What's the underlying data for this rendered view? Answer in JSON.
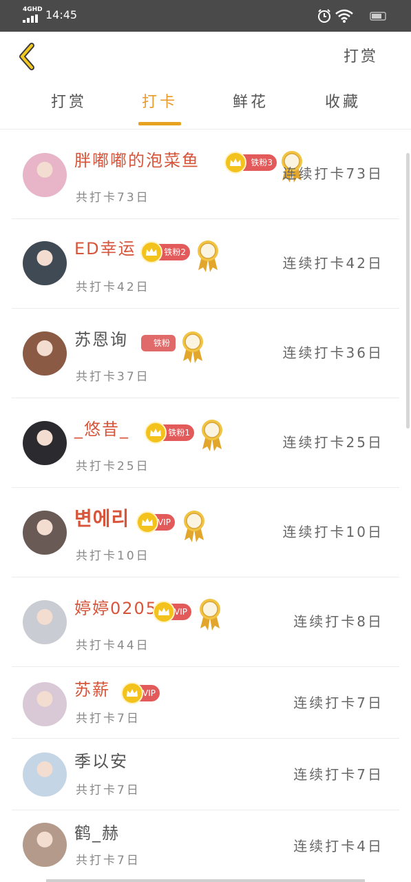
{
  "status_bar": {
    "network": "4GHD",
    "time": "14:45"
  },
  "header": {
    "right_link": "打赏"
  },
  "tabs": [
    {
      "label": "打赏",
      "active": false
    },
    {
      "label": "打卡",
      "active": true
    },
    {
      "label": "鲜花",
      "active": false
    },
    {
      "label": "收藏",
      "active": false
    }
  ],
  "rows": [
    {
      "name": "胖嘟嘟的泡菜鱼",
      "badge": "铁粉3",
      "total": "共打卡73日",
      "streak": "连续打卡73日",
      "avatar_color": "#e8b4c8"
    },
    {
      "name": "ED幸运",
      "badge": "铁粉2",
      "total": "共打卡42日",
      "streak": "连续打卡42日",
      "avatar_color": "#3f4a55"
    },
    {
      "name": "苏恩询",
      "badge": "铁粉",
      "total": "共打卡37日",
      "streak": "连续打卡36日",
      "avatar_color": "#8a5a44"
    },
    {
      "name": "_悠昔_",
      "badge": "铁粉1",
      "total": "共打卡25日",
      "streak": "连续打卡25日",
      "avatar_color": "#2b2b2f"
    },
    {
      "name": "변에리",
      "badge": "VIP",
      "total": "共打卡10日",
      "streak": "连续打卡10日",
      "avatar_color": "#6a5a55"
    },
    {
      "name": "婷婷0205",
      "badge": "VIP",
      "total": "共打卡44日",
      "streak": "连续打卡8日",
      "avatar_color": "#c9ccd2"
    },
    {
      "name": "苏薪",
      "badge": "VIP",
      "total": "共打卡7日",
      "streak": "连续打卡7日",
      "avatar_color": "#d9c8d6"
    },
    {
      "name": "季以安",
      "badge": "",
      "total": "共打卡7日",
      "streak": "连续打卡7日",
      "avatar_color": "#c4d5e6"
    },
    {
      "name": "鹤_赫",
      "badge": "",
      "total": "共打卡7日",
      "streak": "连续打卡4日",
      "avatar_color": "#b39a8a"
    }
  ],
  "colors": {
    "accent": "#e7a21f",
    "name_red": "#d7553a",
    "badge_red": "#e35a5a",
    "gold": "#f3c21c"
  }
}
